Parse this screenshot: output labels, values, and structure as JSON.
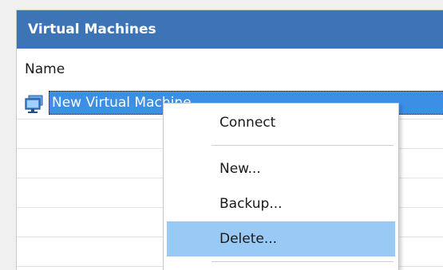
{
  "panel": {
    "title": "Virtual Machines",
    "column_header": "Name",
    "accent_color": "#3c74b6",
    "selection_color": "#3d8ee6"
  },
  "rows": [
    {
      "name": "New Virtual Machine",
      "selected": true,
      "icon": "virtual-machine-icon"
    },
    {
      "name": ""
    },
    {
      "name": ""
    },
    {
      "name": ""
    },
    {
      "name": ""
    }
  ],
  "context_menu": {
    "items": [
      {
        "label": "Connect"
      },
      {
        "label": "New..."
      },
      {
        "label": "Backup..."
      },
      {
        "label": "Delete...",
        "highlighted": true
      }
    ],
    "highlight_color": "#99c9f5"
  }
}
